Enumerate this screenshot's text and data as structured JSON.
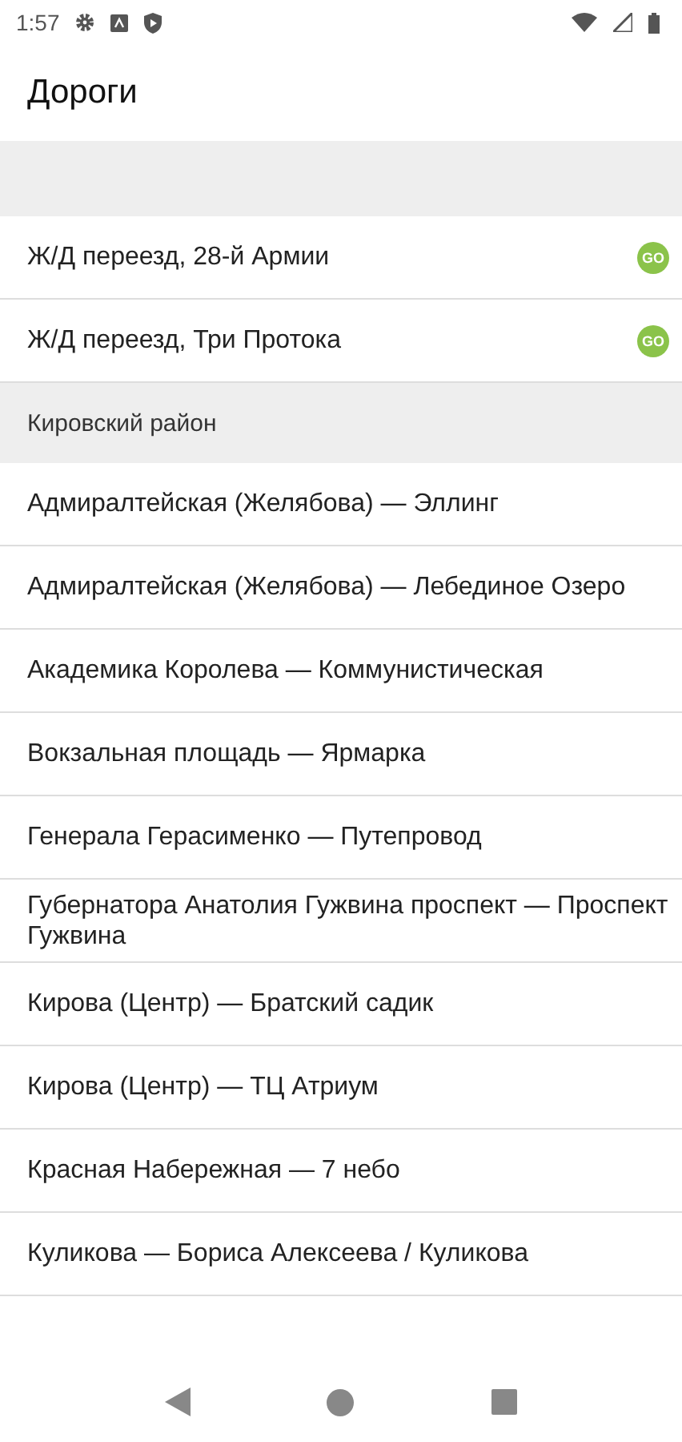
{
  "status_bar": {
    "time": "1:57"
  },
  "app_bar": {
    "title": "Дороги"
  },
  "list": [
    {
      "kind": "item",
      "label": "Ж/Д переезд, 28-й Армии",
      "badge": "GO"
    },
    {
      "kind": "item",
      "label": "Ж/Д переезд, Три Протока",
      "badge": "GO"
    },
    {
      "kind": "header",
      "label": "Кировский район"
    },
    {
      "kind": "item",
      "label": "Адмиралтейская (Желябова) — Эллинг"
    },
    {
      "kind": "item",
      "label": "Адмиралтейская (Желябова) — Лебединое Озеро"
    },
    {
      "kind": "item",
      "label": "Академика Королева — Коммунистическая"
    },
    {
      "kind": "item",
      "label": "Вокзальная площадь — Ярмарка"
    },
    {
      "kind": "item",
      "label": "Генерала Герасименко — Путепровод"
    },
    {
      "kind": "item",
      "label": "Губернатора Анатолия Гужвина проспект — Проспект Гужвина"
    },
    {
      "kind": "item",
      "label": "Кирова (Центр) — Братский садик"
    },
    {
      "kind": "item",
      "label": "Кирова (Центр) — ТЦ Атриум"
    },
    {
      "kind": "item",
      "label": "Красная Набережная — 7 небо"
    },
    {
      "kind": "item",
      "label": "Куликова — Бориса Алексеева / Куликова"
    }
  ]
}
